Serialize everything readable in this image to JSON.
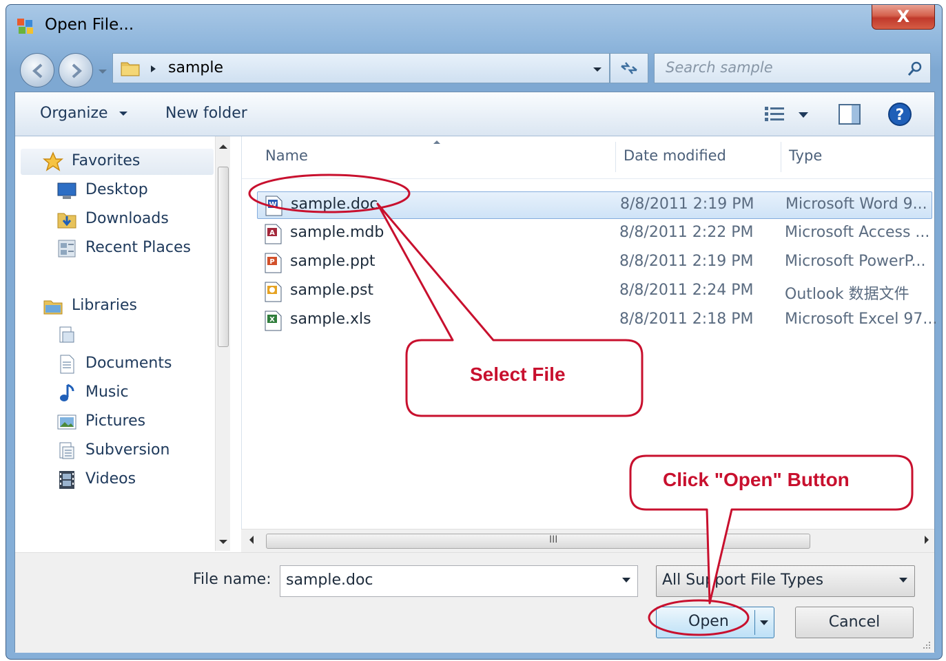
{
  "window": {
    "title": "Open File...",
    "close_glyph": "X"
  },
  "address": {
    "crumb": "sample",
    "search_placeholder": "Search sample"
  },
  "toolbar": {
    "organize": "Organize",
    "new_folder": "New folder"
  },
  "sidebar": {
    "favorites": "Favorites",
    "favorites_items": [
      "Desktop",
      "Downloads",
      "Recent Places"
    ],
    "libraries": "Libraries",
    "libraries_items": [
      "Documents",
      "Music",
      "Pictures",
      "Subversion",
      "Videos"
    ]
  },
  "columns": {
    "name": "Name",
    "date": "Date modified",
    "type": "Type"
  },
  "files": [
    {
      "name": "sample.doc",
      "date": "8/8/2011 2:19 PM",
      "type": "Microsoft Word 9...",
      "icon": "word-doc-icon",
      "selected": true
    },
    {
      "name": "sample.mdb",
      "date": "8/8/2011 2:22 PM",
      "type": "Microsoft Access ...",
      "icon": "access-db-icon",
      "selected": false
    },
    {
      "name": "sample.ppt",
      "date": "8/8/2011 2:19 PM",
      "type": "Microsoft PowerP...",
      "icon": "powerpoint-icon",
      "selected": false
    },
    {
      "name": "sample.pst",
      "date": "8/8/2011 2:24 PM",
      "type": "Outlook 数据文件",
      "icon": "outlook-pst-icon",
      "selected": false
    },
    {
      "name": "sample.xls",
      "date": "8/8/2011 2:18 PM",
      "type": "Microsoft Excel 97...",
      "icon": "excel-icon",
      "selected": false
    }
  ],
  "hscroll_grip": "III",
  "bottom": {
    "file_name_label": "File name:",
    "file_name_value": "sample.doc",
    "file_type": "All Support File Types",
    "open": "Open",
    "cancel": "Cancel"
  },
  "annotations": {
    "select_file": "Select File",
    "click_open": "Click \"Open\" Button",
    "color": "#c8102e"
  }
}
